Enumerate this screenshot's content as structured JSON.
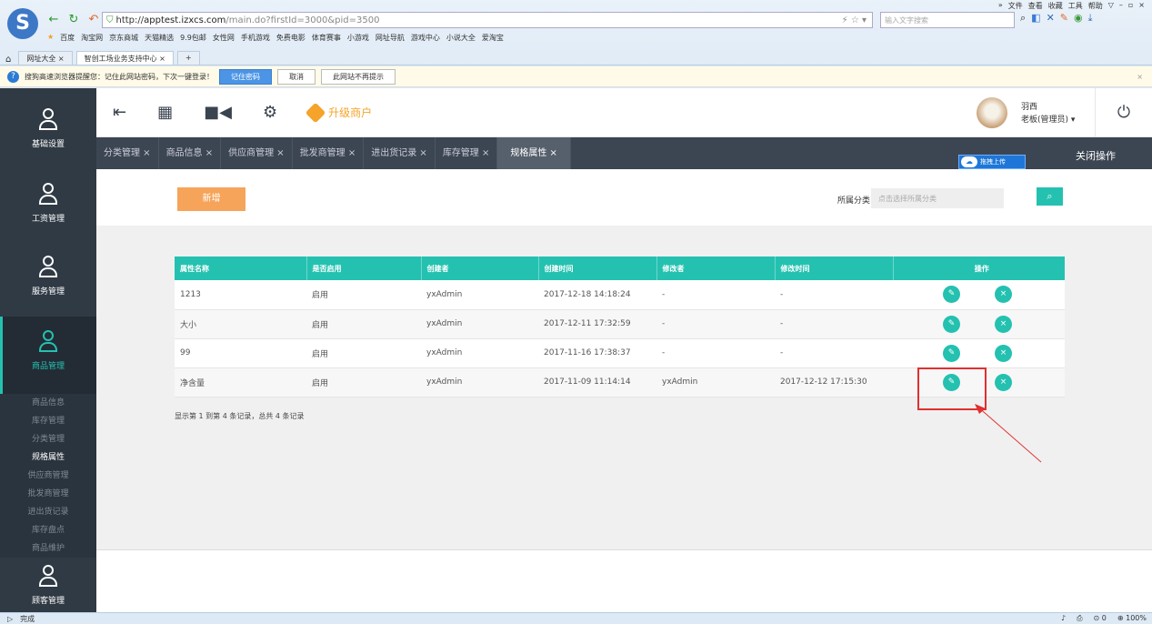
{
  "browser": {
    "top_menu": [
      "»",
      "文件",
      "查看",
      "收藏",
      "工具",
      "帮助"
    ],
    "window_controls": [
      "▽",
      "–",
      "▫",
      "×"
    ],
    "url_prefix": "http://",
    "url_domain": "apptest.izxcs.com",
    "url_rest": "/main.do?firstId=3000&pid=3500",
    "search_placeholder": "输入文字搜索",
    "favorites": [
      "百度",
      "淘宝网",
      "京东商城",
      "天猫精选",
      "9.9包邮",
      "女性网",
      "手机游戏",
      "免费电影",
      "体育赛事",
      "小游戏",
      "网址导航",
      "游戏中心",
      "小说大全",
      "爱淘宝"
    ],
    "tabs": [
      "网址大全",
      "智创工场业务支持中心"
    ],
    "notice_text": "搜狗高速浏览器提醒您：记住此网站密码，下次一键登录！",
    "notice_btn_remember": "记住密码",
    "notice_btn_cancel": "取消",
    "notice_btn_never": "此网站不再提示",
    "status_left": "完成",
    "status_zoom": "100%",
    "status_count": "0"
  },
  "sidebar": {
    "sections": [
      "基础设置",
      "工资管理",
      "服务管理",
      "商品管理",
      "顾客管理"
    ],
    "submenu": [
      "商品信息",
      "库存管理",
      "分类管理",
      "规格属性",
      "供应商管理",
      "批发商管理",
      "进出货记录",
      "库存盘点",
      "商品维护"
    ]
  },
  "header": {
    "upgrade_label": "升级商户",
    "user_name": "羽西",
    "user_role": "老板(管理员)"
  },
  "tabs": [
    "分类管理 ×",
    "商品信息 ×",
    "供应商管理 ×",
    "批发商管理 ×",
    "进出货记录 ×",
    "库存管理 ×",
    "规格属性 ×"
  ],
  "tab_right": "关闭操作",
  "upload_label": "拖拽上传",
  "toolbar": {
    "add_label": "新增",
    "category_label": "所属分类:",
    "category_placeholder": "点击选择所属分类"
  },
  "table": {
    "headers": [
      "属性名称",
      "是否启用",
      "创建者",
      "创建时间",
      "修改者",
      "修改时间",
      "操作"
    ],
    "rows": [
      [
        "1213",
        "启用",
        "yxAdmin",
        "2017-12-18 14:18:24",
        "-",
        "-"
      ],
      [
        "大小",
        "启用",
        "yxAdmin",
        "2017-12-11 17:32:59",
        "-",
        "-"
      ],
      [
        "99",
        "启用",
        "yxAdmin",
        "2017-11-16 17:38:37",
        "-",
        "-"
      ],
      [
        "净含量",
        "启用",
        "yxAdmin",
        "2017-11-09 11:14:14",
        "yxAdmin",
        "2017-12-12 17:15:30"
      ]
    ]
  },
  "footer_info": "显示第 1 到第 4 条记录，总共 4 条记录",
  "colors": {
    "accent": "#24c1b0",
    "add": "#f6a45a",
    "sidebar": "#2f3a44",
    "highlight": "#e03030"
  }
}
